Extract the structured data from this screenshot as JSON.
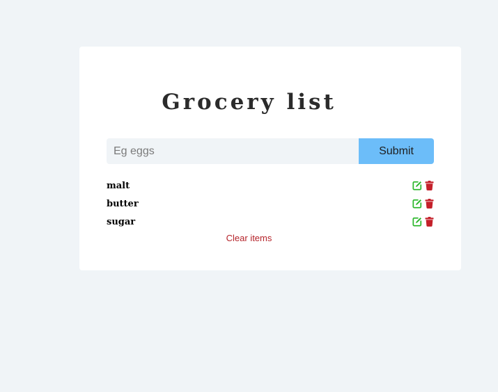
{
  "app": {
    "title": "Grocery list"
  },
  "form": {
    "placeholder": "Eg eggs",
    "value": "",
    "submit_label": "Submit"
  },
  "items": [
    {
      "name": "malt"
    },
    {
      "name": "butter"
    },
    {
      "name": "sugar"
    }
  ],
  "icons": {
    "edit": "edit-icon",
    "delete": "trash-icon"
  },
  "colors": {
    "background": "#f0f4f7",
    "card": "#ffffff",
    "submit_button": "#6cbdf9",
    "edit_icon": "#2eb82e",
    "delete_icon": "#c4202a",
    "clear_text": "#b5232a"
  },
  "clear_label": "Clear items"
}
